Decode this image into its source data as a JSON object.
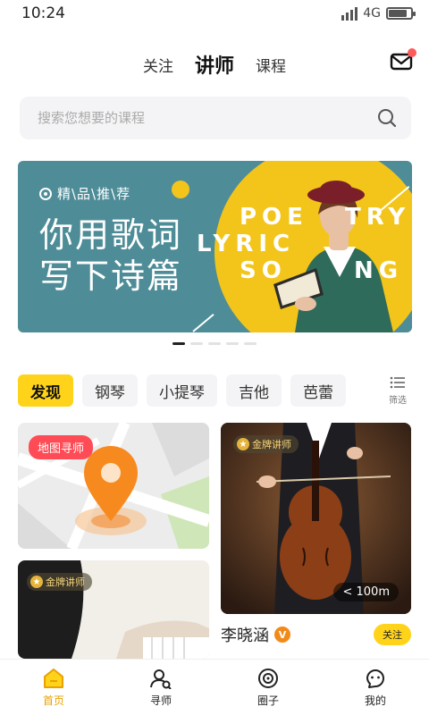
{
  "status": {
    "time": "10:24",
    "network": "4G",
    "battery_level": 0.85
  },
  "top_tabs": [
    {
      "label": "关注",
      "active": false
    },
    {
      "label": "讲师",
      "active": true
    },
    {
      "label": "课程",
      "active": false
    }
  ],
  "search": {
    "placeholder": "搜索您想要的课程"
  },
  "banner": {
    "tag": "精\\品\\推\\荐",
    "title_line1": "你用歌词",
    "title_line2": "写下诗篇",
    "en_1": "POE",
    "en_2": "TRY",
    "en_3": "LYRIC",
    "en_4": "SO",
    "en_5": "NG",
    "page_count": 5,
    "active_page": 1
  },
  "categories": [
    {
      "label": "发现",
      "active": true
    },
    {
      "label": "钢琴",
      "active": false
    },
    {
      "label": "小提琴",
      "active": false
    },
    {
      "label": "吉他",
      "active": false
    },
    {
      "label": "芭蕾",
      "active": false
    }
  ],
  "filter_label": "筛选",
  "cards": {
    "map_badge": "地图寻师",
    "gold_badge": "金牌讲师",
    "distance": "< 100m",
    "teacher_name": "李晓涵",
    "verified_mark": "V",
    "follow_label": "关注"
  },
  "bottom_nav": [
    {
      "label": "首页",
      "icon": "home-icon",
      "active": true
    },
    {
      "label": "寻师",
      "icon": "find-teacher-icon",
      "active": false
    },
    {
      "label": "圈子",
      "icon": "circle-icon",
      "active": false
    },
    {
      "label": "我的",
      "icon": "profile-icon",
      "active": false
    }
  ],
  "colors": {
    "accent": "#ffd31a",
    "banner_bg": "#4e8d98",
    "badge_red": "#ff4b55",
    "nav_active": "#e8a100"
  }
}
